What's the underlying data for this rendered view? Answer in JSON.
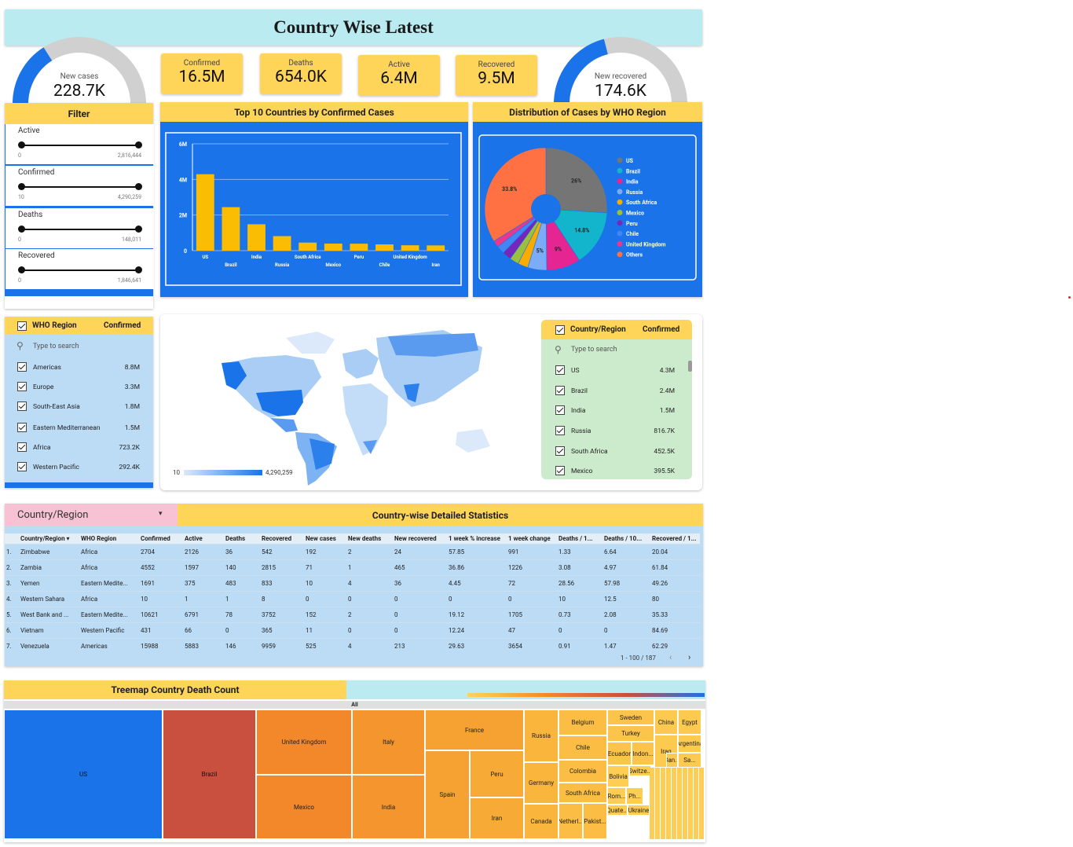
{
  "title": "Country Wise Latest",
  "gauges": {
    "new_cases": {
      "label": "New cases",
      "value": "228.7K",
      "fill": 0.32
    },
    "new_recovered": {
      "label": "New recovered",
      "value": "174.6K",
      "fill": 0.42
    }
  },
  "kpis": [
    {
      "label": "Confirmed",
      "value": "16.5M"
    },
    {
      "label": "Deaths",
      "value": "654.0K"
    },
    {
      "label": "Active",
      "value": "6.4M"
    },
    {
      "label": "Recovered",
      "value": "9.5M"
    }
  ],
  "filter": {
    "title": "Filter",
    "sliders": [
      {
        "label": "Active",
        "min": "0",
        "max": "2,816,444"
      },
      {
        "label": "Confirmed",
        "min": "10",
        "max": "4,290,259"
      },
      {
        "label": "Deaths",
        "min": "0",
        "max": "148,011"
      },
      {
        "label": "Recovered",
        "min": "0",
        "max": "1,846,641"
      }
    ]
  },
  "who_list": {
    "col1": "WHO Region",
    "col2": "Confirmed",
    "search_placeholder": "Type to search",
    "rows": [
      {
        "name": "Americas",
        "value": "8.8M"
      },
      {
        "name": "Europe",
        "value": "3.3M"
      },
      {
        "name": "South-East Asia",
        "value": "1.8M"
      },
      {
        "name": "Eastern Mediterranean",
        "value": "1.5M"
      },
      {
        "name": "Africa",
        "value": "723.2K"
      },
      {
        "name": "Western Pacific",
        "value": "292.4K"
      }
    ]
  },
  "country_list": {
    "col1": "Country/Region",
    "col2": "Confirmed",
    "search_placeholder": "Type to search",
    "rows": [
      {
        "name": "US",
        "value": "4.3M"
      },
      {
        "name": "Brazil",
        "value": "2.4M"
      },
      {
        "name": "India",
        "value": "1.5M"
      },
      {
        "name": "Russia",
        "value": "816.7K"
      },
      {
        "name": "South Africa",
        "value": "452.5K"
      },
      {
        "name": "Mexico",
        "value": "395.5K"
      }
    ]
  },
  "map": {
    "legend_min": "10",
    "legend_max": "4,290,259"
  },
  "chart_data": [
    {
      "type": "bar",
      "title": "Top 10 Countries by Confirmed Cases",
      "categories": [
        "US",
        "Brazil",
        "India",
        "Russia",
        "South Africa",
        "Mexico",
        "Peru",
        "Chile",
        "United Kingdom",
        "Iran"
      ],
      "values": [
        4290259,
        2442375,
        1480073,
        816680,
        452529,
        395489,
        389717,
        347923,
        301708,
        293606
      ],
      "ylim": [
        0,
        6000000
      ],
      "yticks": [
        "0",
        "2M",
        "4M",
        "6M"
      ],
      "color": "#fbbc04"
    },
    {
      "type": "pie",
      "title": "Distribution of Cases by WHO Region",
      "labels": [
        "US",
        "Brazil",
        "India",
        "Russia",
        "South Africa",
        "Mexico",
        "Peru",
        "Chile",
        "United Kingdom",
        "Others"
      ],
      "values": [
        26,
        14.8,
        9,
        5,
        2.7,
        2.4,
        2.4,
        2.1,
        1.8,
        33.8
      ],
      "slice_labels": [
        "26%",
        "14.8%",
        "9%",
        "5%",
        "",
        "",
        "",
        "",
        "",
        "33.8%"
      ],
      "colors": [
        "#757575",
        "#12b5cb",
        "#e52592",
        "#7cacf8",
        "#f9ab00",
        "#9bbf3f",
        "#7627bb",
        "#4285f4",
        "#e8378f",
        "#ff7043"
      ]
    }
  ],
  "table": {
    "dropdown_label": "Country/Region",
    "title": "Country-wise Detailed Statistics",
    "columns": [
      "",
      "Country/Region ▾",
      "WHO Region",
      "Confirmed",
      "Active",
      "Deaths",
      "Recovered",
      "New cases",
      "New deaths",
      "New recovered",
      "1 week % increase",
      "1 week change",
      "Deaths / 1...",
      "Deaths / 10...",
      "Recovered / 1..."
    ],
    "rows": [
      [
        "1.",
        "Zimbabwe",
        "Africa",
        "2704",
        "2126",
        "36",
        "542",
        "192",
        "2",
        "24",
        "57.85",
        "991",
        "1.33",
        "6.64",
        "20.04"
      ],
      [
        "2.",
        "Zambia",
        "Africa",
        "4552",
        "1597",
        "140",
        "2815",
        "71",
        "1",
        "465",
        "36.86",
        "1226",
        "3.08",
        "4.97",
        "61.84"
      ],
      [
        "3.",
        "Yemen",
        "Eastern Medite...",
        "1691",
        "375",
        "483",
        "833",
        "10",
        "4",
        "36",
        "4.45",
        "72",
        "28.56",
        "57.98",
        "49.26"
      ],
      [
        "4.",
        "Western Sahara",
        "Africa",
        "10",
        "1",
        "1",
        "8",
        "0",
        "0",
        "0",
        "0",
        "0",
        "10",
        "12.5",
        "80"
      ],
      [
        "5.",
        "West Bank and ...",
        "Eastern Medite...",
        "10621",
        "6791",
        "78",
        "3752",
        "152",
        "2",
        "0",
        "19.12",
        "1705",
        "0.73",
        "2.08",
        "35.33"
      ],
      [
        "6.",
        "Vietnam",
        "Western Pacific",
        "431",
        "66",
        "0",
        "365",
        "11",
        "0",
        "0",
        "12.24",
        "47",
        "0",
        "0",
        "84.69"
      ],
      [
        "7.",
        "Venezuela",
        "Americas",
        "15988",
        "5883",
        "146",
        "9959",
        "525",
        "4",
        "213",
        "29.63",
        "3654",
        "0.91",
        "1.47",
        "62.29"
      ]
    ],
    "pagination": "1 - 100 / 187"
  },
  "treemap": {
    "title": "Treemap Country Death Count",
    "root_label": "All",
    "tiles": [
      {
        "name": "US",
        "color": "#1a73e8"
      },
      {
        "name": "Brazil",
        "color": "#c9503f"
      },
      {
        "name": "United Kingdom",
        "color": "#f3882b"
      },
      {
        "name": "Mexico",
        "color": "#f3882b"
      },
      {
        "name": "Italy",
        "color": "#f5952e"
      },
      {
        "name": "India",
        "color": "#f5952e"
      },
      {
        "name": "France",
        "color": "#f6a232"
      },
      {
        "name": "Spain",
        "color": "#f6a232"
      },
      {
        "name": "Peru",
        "color": "#f7aa36"
      },
      {
        "name": "Iran",
        "color": "#f7aa36"
      },
      {
        "name": "Russia",
        "color": "#fab53d"
      },
      {
        "name": "Germany",
        "color": "#fab53d"
      },
      {
        "name": "Canada",
        "color": "#fab53d"
      },
      {
        "name": "Belgium",
        "color": "#fbbd43"
      },
      {
        "name": "Chile",
        "color": "#fbbd43"
      },
      {
        "name": "Colombia",
        "color": "#fbbd43"
      },
      {
        "name": "South Africa",
        "color": "#fbbd43"
      },
      {
        "name": "Netherl...",
        "color": "#fbbd43"
      },
      {
        "name": "Pakist...",
        "color": "#fbbd43"
      },
      {
        "name": "Sweden",
        "color": "#fcc44b"
      },
      {
        "name": "Turkey",
        "color": "#fcc44b"
      },
      {
        "name": "Ecuador",
        "color": "#fcc44b"
      },
      {
        "name": "Indon...",
        "color": "#fcc44b"
      },
      {
        "name": "China",
        "color": "#fdca50"
      },
      {
        "name": "Egypt",
        "color": "#fdca50"
      },
      {
        "name": "Argentina",
        "color": "#fdca50"
      },
      {
        "name": "Iraq",
        "color": "#fdca50"
      },
      {
        "name": "Ban...",
        "color": "#fdca50"
      },
      {
        "name": "Sa...",
        "color": "#fdca50"
      },
      {
        "name": "Bolivia",
        "color": "#fdcd54"
      },
      {
        "name": "Switze...",
        "color": "#fdcd54"
      },
      {
        "name": "Rom...",
        "color": "#fdcd54"
      },
      {
        "name": "Ph...",
        "color": "#fdcd54"
      },
      {
        "name": "Quate...",
        "color": "#fdcd54"
      },
      {
        "name": "Ukraine",
        "color": "#fdcd54"
      }
    ]
  }
}
